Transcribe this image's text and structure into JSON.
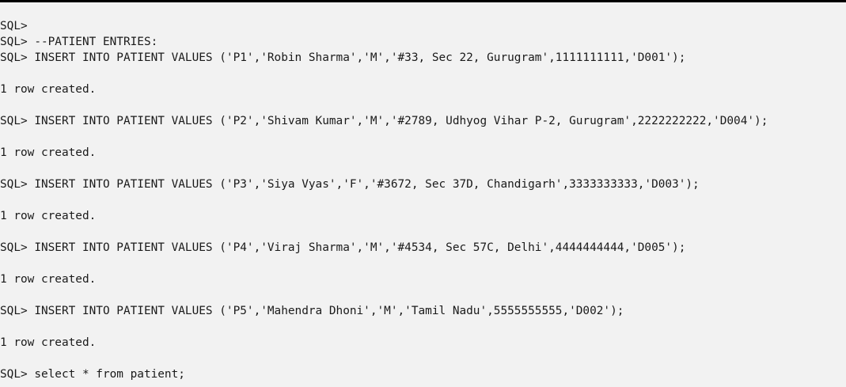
{
  "terminal": {
    "lines": [
      "SQL>",
      "SQL> --PATIENT ENTRIES:",
      "SQL> INSERT INTO PATIENT VALUES ('P1','Robin Sharma','M','#33, Sec 22, Gurugram',1111111111,'D001');",
      "",
      "1 row created.",
      "",
      "SQL> INSERT INTO PATIENT VALUES ('P2','Shivam Kumar','M','#2789, Udhyog Vihar P-2, Gurugram',2222222222,'D004');",
      "",
      "1 row created.",
      "",
      "SQL> INSERT INTO PATIENT VALUES ('P3','Siya Vyas','F','#3672, Sec 37D, Chandigarh',3333333333,'D003');",
      "",
      "1 row created.",
      "",
      "SQL> INSERT INTO PATIENT VALUES ('P4','Viraj Sharma','M','#4534, Sec 57C, Delhi',4444444444,'D005');",
      "",
      "1 row created.",
      "",
      "SQL> INSERT INTO PATIENT VALUES ('P5','Mahendra Dhoni','M','Tamil Nadu',5555555555,'D002');",
      "",
      "1 row created.",
      "",
      "SQL> select * from patient;"
    ]
  }
}
